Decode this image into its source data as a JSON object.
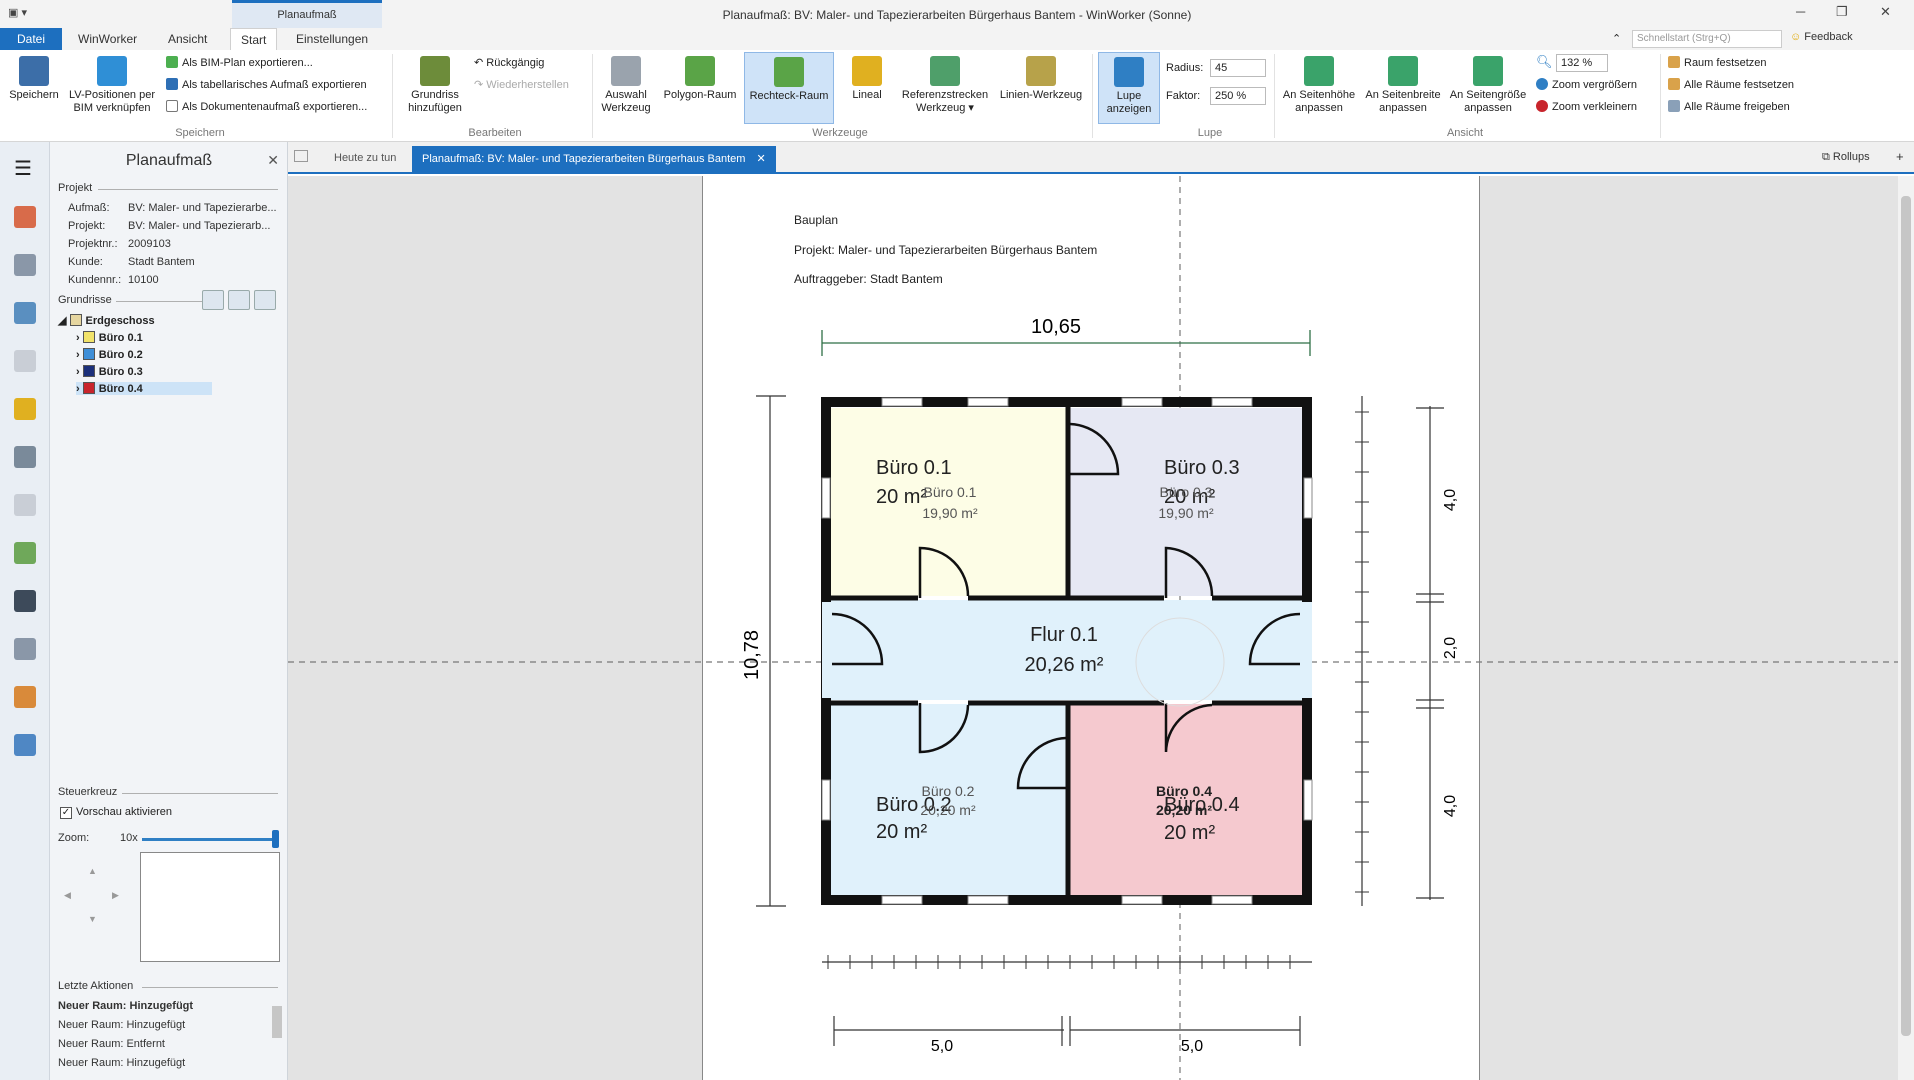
{
  "window": {
    "title": "Planaufmaß: BV: Maler- und Tapezierarbeiten Bürgerhaus Bantem - WinWorker (Sonne)",
    "context_tab": "Planaufmaß",
    "search_placeholder": "Schnellstart (Strg+Q)",
    "feedback": "Feedback"
  },
  "ribbon_tabs": [
    "Datei",
    "WinWorker",
    "Ansicht",
    "Start",
    "Einstellungen"
  ],
  "ribbon": {
    "save": "Speichern",
    "lv_link": "LV-Positionen per BIM verknüpfen",
    "export_bim": "Als BIM-Plan exportieren...",
    "export_table": "Als tabellarisches Aufmaß exportieren",
    "export_doc": "Als Dokumentenaufmaß exportieren...",
    "group_save": "Speichern",
    "add_plan": "Grundriss hinzufügen",
    "undo": "Rückgängig",
    "redo": "Wiederherstellen",
    "group_edit": "Bearbeiten",
    "select_tool": "Auswahl Werkzeug",
    "polygon_room": "Polygon-Raum",
    "rect_room": "Rechteck-Raum",
    "ruler": "Lineal",
    "ref_tool": "Referenzstrecken Werkzeug",
    "line_tool": "Linien-Werkzeug",
    "group_tools": "Werkzeuge",
    "show_lens": "Lupe anzeigen",
    "radius_label": "Radius:",
    "radius_value": "45",
    "factor_label": "Faktor:",
    "factor_value": "250 %",
    "group_lens": "Lupe",
    "fit_height": "An Seitenhöhe anpassen",
    "fit_width": "An Seitenbreite anpassen",
    "fit_page": "An Seitengröße anpassen",
    "zoom_value": "132 %",
    "zoom_in": "Zoom vergrößern",
    "zoom_out": "Zoom verkleinern",
    "group_view": "Ansicht",
    "fix_room": "Raum festsetzen",
    "fix_all": "Alle Räume festsetzen",
    "release_all": "Alle Räume freigeben"
  },
  "panel": {
    "title": "Planaufmaß",
    "project_section": "Projekt",
    "fields": [
      {
        "k": "Aufmaß:",
        "v": "BV: Maler- und Tapezierarbe..."
      },
      {
        "k": "Projekt:",
        "v": "BV: Maler- und Tapezierarb..."
      },
      {
        "k": "Projektnr.:",
        "v": "2009103"
      },
      {
        "k": "Kunde:",
        "v": "Stadt Bantem"
      },
      {
        "k": "Kundennr.:",
        "v": "10100"
      }
    ],
    "plans_section": "Grundrisse",
    "floor": "Erdgeschoss",
    "rooms": [
      {
        "name": "Büro 0.1",
        "color": "#f2e36a"
      },
      {
        "name": "Büro 0.2",
        "color": "#3f8fd8"
      },
      {
        "name": "Büro 0.3",
        "color": "#1b2f7a"
      },
      {
        "name": "Büro 0.4",
        "color": "#c8242c"
      }
    ],
    "control_section": "Steuerkreuz",
    "preview_label": "Vorschau aktivieren",
    "zoom_label": "Zoom:",
    "zoom_value": "10x",
    "last_actions_section": "Letzte Aktionen",
    "actions": [
      "Neuer Raum: Hinzugefügt",
      "Neuer Raum: Hinzugefügt",
      "Neuer Raum: Entfernt",
      "Neuer Raum: Hinzugefügt"
    ]
  },
  "doc_tabs": {
    "today": "Heute zu tun",
    "active": "Planaufmaß: BV: Maler- und Tapezierarbeiten Bürgerhaus Bantem",
    "rollups": "Rollups"
  },
  "plan": {
    "header1": "Bauplan",
    "header2": "Projekt: Maler- und Tapezierarbeiten Bürgerhaus Bantem",
    "header3": "Auftraggeber: Stadt Bantem",
    "dim_top": "10,65",
    "dim_left": "10,78",
    "dim_right_top": "4,0",
    "dim_right_mid": "2,0",
    "dim_right_bottom": "4,0",
    "dim_bottom_left": "5,0",
    "dim_bottom_right": "5,0",
    "rooms": [
      {
        "id": "buero01",
        "label": "Büro 0.1",
        "area": "20 m²",
        "sub_label": "Büro 0.1",
        "sub_area": "19,90 m²",
        "fill": "#fdfde6"
      },
      {
        "id": "buero03",
        "label": "Büro 0.3",
        "area": "20 m²",
        "sub_label": "Büro 0.3",
        "sub_area": "19,90 m²",
        "fill": "#e6e8f3"
      },
      {
        "id": "flur",
        "label": "Flur 0.1",
        "area": "20,26 m²",
        "fill": "#e0f1fb"
      },
      {
        "id": "buero02",
        "label": "Büro 0.2",
        "area": "20 m²",
        "sub_label": "Büro 0.2",
        "sub_area": "20,20 m²",
        "fill": "#e0f1fb"
      },
      {
        "id": "buero04",
        "label": "Büro 0.4",
        "area": "20 m²",
        "sub_label": "Büro 0.4",
        "sub_area": "20,20 m²",
        "fill": "#f5c9cf"
      }
    ]
  }
}
